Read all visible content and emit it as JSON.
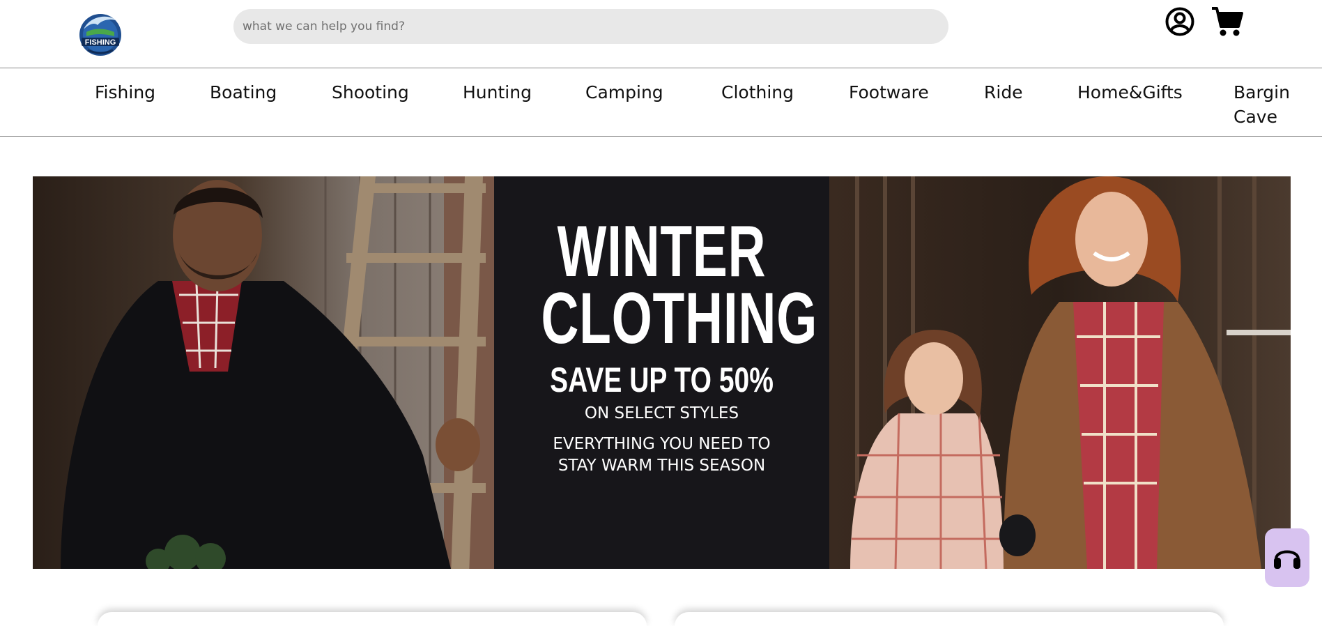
{
  "header": {
    "logo": {
      "icon": "fishing-logo-icon",
      "text": "FISHING"
    },
    "search": {
      "placeholder": "what we can help you find?",
      "value": ""
    },
    "account_icon": "account-icon",
    "cart_icon": "cart-icon"
  },
  "nav": {
    "items": [
      {
        "label": "Fishing"
      },
      {
        "label": "Boating"
      },
      {
        "label": "Shooting"
      },
      {
        "label": "Hunting"
      },
      {
        "label": "Camping"
      },
      {
        "label": "Clothing"
      },
      {
        "label": "Footware"
      },
      {
        "label": "Ride"
      },
      {
        "label": "Home&Gifts"
      },
      {
        "label": "Bargin Cave"
      }
    ]
  },
  "hero": {
    "title_line1": "WINTER",
    "title_line2": "CLOTHING",
    "headline": "SAVE UP TO 50%",
    "subline": "ON SELECT STYLES",
    "tagline": "EVERYTHING YOU NEED TO STAY WARM THIS SEASON"
  },
  "support": {
    "icon": "headset-icon"
  },
  "colors": {
    "hero_background": "#17161a",
    "search_background": "#e8e8e8",
    "support_background": "#d8c3f0",
    "logo_blue": "#1f4e8f"
  }
}
